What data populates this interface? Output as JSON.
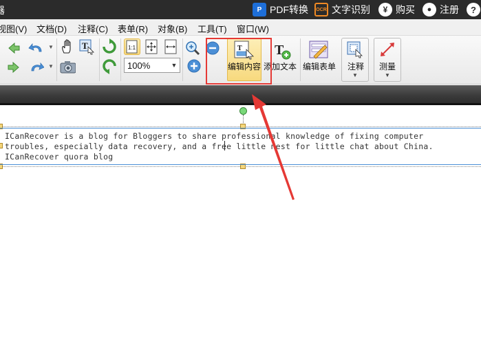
{
  "titlebar": {
    "app_glyph": "器",
    "pdf_convert": "PDF转换",
    "ocr": "文字识别",
    "ocr_badge": "OCR",
    "buy": "购买",
    "register": "注册",
    "help": "?"
  },
  "menu": {
    "view": "视图(V)",
    "document": "文档(D)",
    "comment": "注释(C)",
    "form": "表单(R)",
    "object": "对象(B)",
    "tools": "工具(T)",
    "window": "窗口(W)"
  },
  "toolbar": {
    "zoom_value": "100%",
    "actual_size_label": "1:1",
    "edit_content": "编辑内容",
    "add_text": "添加文本",
    "edit_form": "编辑表单",
    "annotate": "注释",
    "measure": "测量"
  },
  "document": {
    "line1": "ICanRecover is a blog for Bloggers to share professional knowledge of fixing computer",
    "line2": "troubles, especially data recovery, and a free little nest for little chat about China.",
    "line3": "ICanRecover quora blog"
  },
  "colors": {
    "highlight_box": "#e53935",
    "title_bar": "#2b2b2b",
    "active_tool": "#f7d97e"
  }
}
